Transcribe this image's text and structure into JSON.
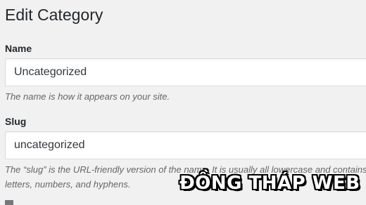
{
  "page": {
    "title": "Edit Category"
  },
  "form": {
    "name": {
      "label": "Name",
      "value": "Uncategorized",
      "description": "The name is how it appears on your site."
    },
    "slug": {
      "label": "Slug",
      "value": "uncategorized",
      "description": "The “slug” is the URL-friendly version of the name. It is usually all lowercase and contains only letters, numbers, and hyphens."
    }
  },
  "watermark": {
    "text": "ĐỒNG THÁP WEB"
  }
}
